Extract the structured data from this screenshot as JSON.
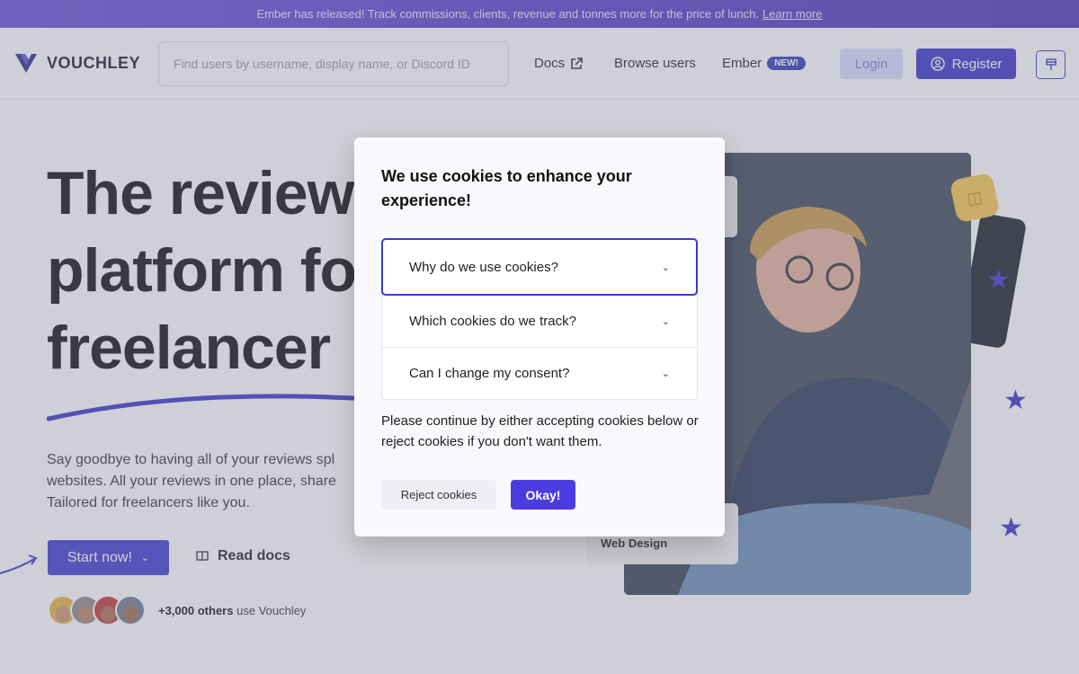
{
  "announcement": {
    "text": "Ember has released! Track commissions, clients, revenue and tonnes more for the price of lunch.",
    "link": "Learn more"
  },
  "header": {
    "logo_text": "VOUCHLEY",
    "search_placeholder": "Find users by username, display name, or Discord ID",
    "nav": {
      "docs": "Docs",
      "browse": "Browse users",
      "ember": "Ember",
      "ember_badge": "NEW!"
    },
    "login": "Login",
    "register": "Register"
  },
  "hero": {
    "title_line1": "The review",
    "title_line2": "platform fo",
    "title_line3": "freelancer",
    "description": "Say goodbye to having all of your reviews spl websites. All your reviews in one place, share Tailored for freelancers like you.",
    "start_button": "Start now!",
    "read_docs": "Read docs",
    "others_count": "+3,000 others",
    "others_suffix": "use Vouchley",
    "web_card_label": "Web Design"
  },
  "cookie_modal": {
    "title": "We use cookies to enhance your experience!",
    "items": [
      {
        "label": "Why do we use cookies?"
      },
      {
        "label": "Which cookies do we track?"
      },
      {
        "label": "Can I change my consent?"
      }
    ],
    "message": "Please continue by either accepting cookies below or reject cookies if you don't want them.",
    "reject": "Reject cookies",
    "accept": "Okay!"
  },
  "colors": {
    "accent": "#3b32c9",
    "announcement_bg": "#5a3fc9",
    "ok_button": "#4b3be0"
  }
}
